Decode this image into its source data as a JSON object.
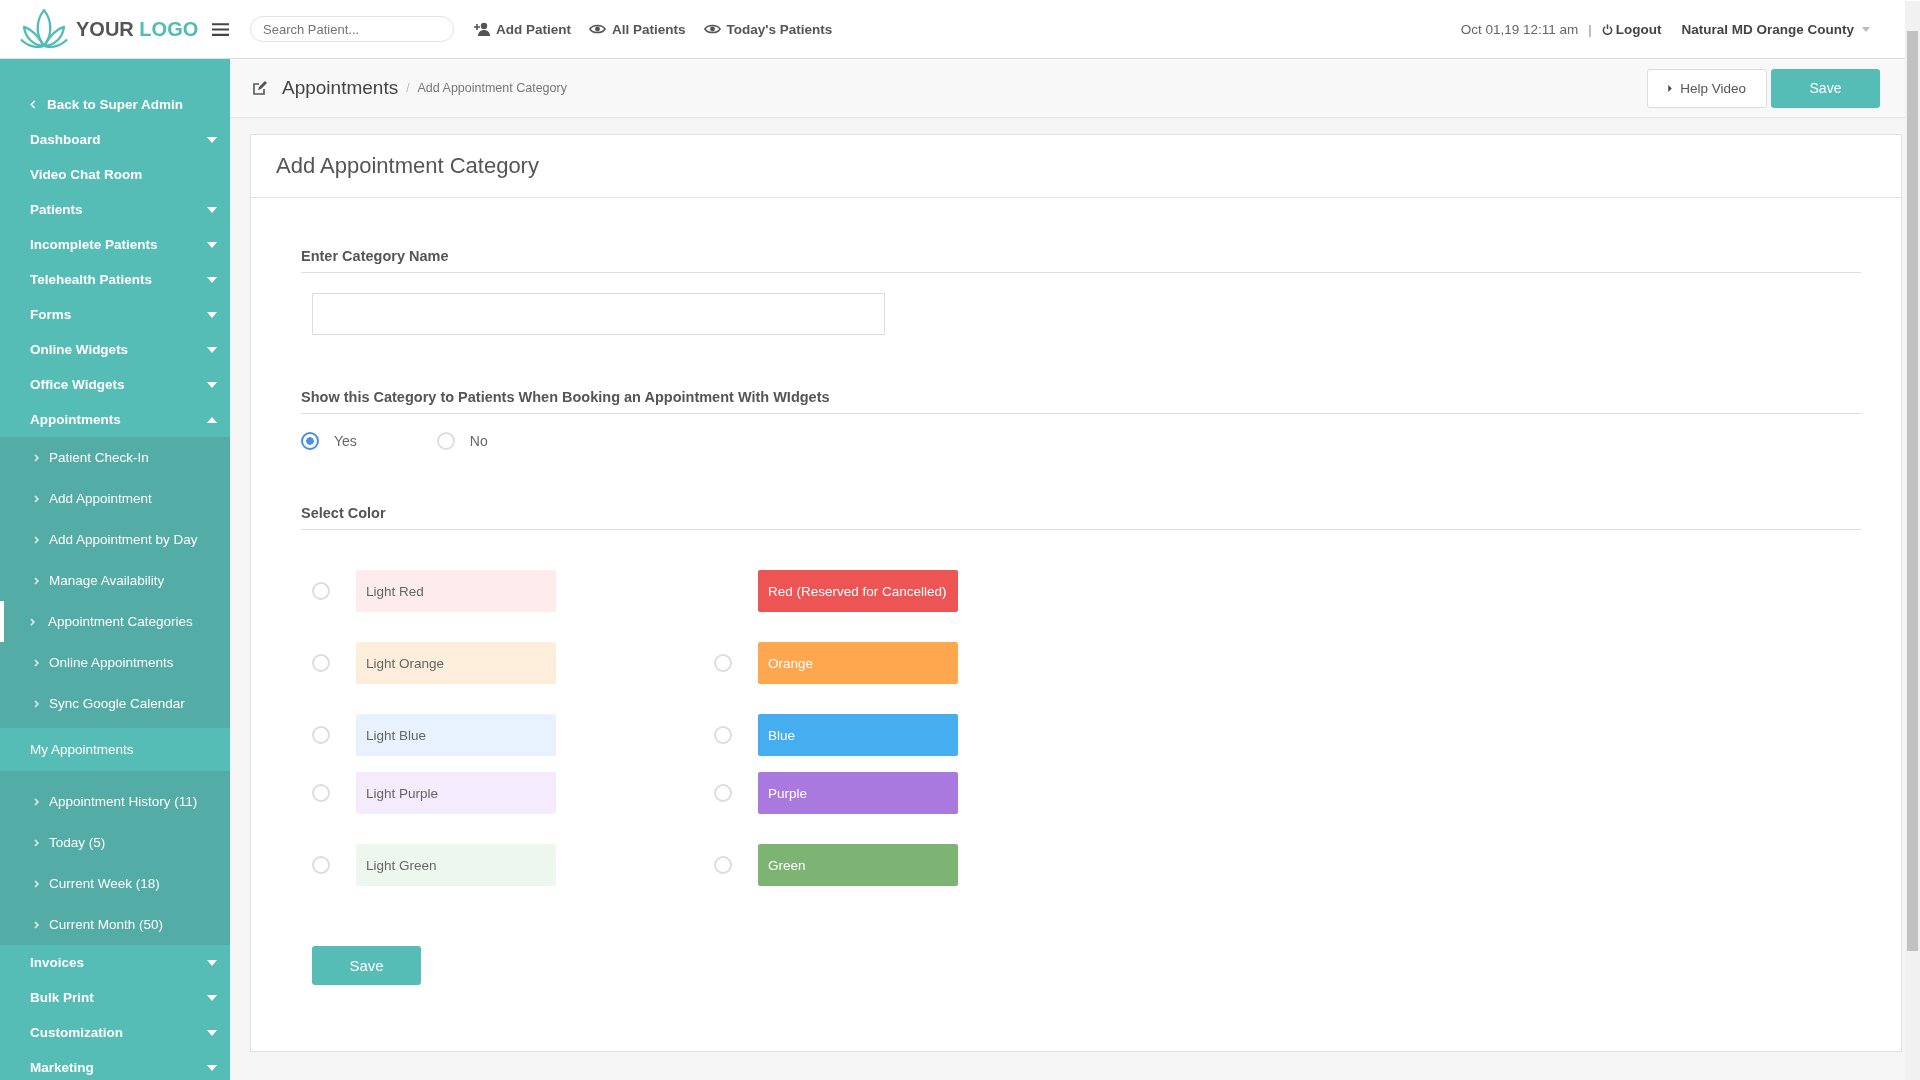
{
  "topbar": {
    "logo": {
      "first": "YOUR",
      "second": "LOGO"
    },
    "search": {
      "placeholder": "Search Patient..."
    },
    "links": [
      {
        "label": "Add Patient",
        "kind": "add-user"
      },
      {
        "label": "All Patients",
        "kind": "eye"
      },
      {
        "label": "Today's Patients",
        "kind": "eye"
      }
    ],
    "datetime": "Oct 01,19 12:11 am",
    "separator": "|",
    "logout": "Logout",
    "account": "Natural MD Orange County"
  },
  "sidebar": {
    "items": [
      {
        "label": "Back to Super Admin",
        "kind": "back"
      },
      {
        "label": "Dashboard",
        "kind": "menu",
        "expanded": false
      },
      {
        "label": "Video Chat Room",
        "kind": "link"
      },
      {
        "label": "Patients",
        "kind": "menu",
        "expanded": false
      },
      {
        "label": "Incomplete Patients",
        "kind": "menu",
        "expanded": false
      },
      {
        "label": "Telehealth Patients",
        "kind": "menu",
        "expanded": false
      },
      {
        "label": "Forms",
        "kind": "menu",
        "expanded": false
      },
      {
        "label": "Online Widgets",
        "kind": "menu",
        "expanded": false
      },
      {
        "label": "Office Widgets",
        "kind": "menu",
        "expanded": false
      },
      {
        "label": "Appointments",
        "kind": "menu",
        "expanded": true,
        "children": [
          {
            "label": "Patient Check-In",
            "kind": "sub",
            "selected": false
          },
          {
            "label": "Add Appointment",
            "kind": "sub",
            "selected": false
          },
          {
            "label": "Add Appointment by Day",
            "kind": "sub",
            "selected": false
          },
          {
            "label": "Manage Availability",
            "kind": "sub",
            "selected": false
          },
          {
            "label": "Appointment Categories",
            "kind": "sub",
            "selected": true
          },
          {
            "label": "Online Appointments",
            "kind": "sub",
            "selected": false
          },
          {
            "label": "Sync Google Calendar",
            "kind": "sub",
            "selected": false
          },
          {
            "label": "My Appointments",
            "kind": "heading"
          },
          {
            "label": "Appointment History (11)",
            "kind": "sub",
            "selected": false
          },
          {
            "label": "Today (5)",
            "kind": "sub",
            "selected": false
          },
          {
            "label": "Current Week (18)",
            "kind": "sub",
            "selected": false
          },
          {
            "label": "Current Month (50)",
            "kind": "sub",
            "selected": false
          }
        ]
      },
      {
        "label": "Invoices",
        "kind": "menu",
        "expanded": false
      },
      {
        "label": "Bulk Print",
        "kind": "menu",
        "expanded": false
      },
      {
        "label": "Customization",
        "kind": "menu",
        "expanded": false
      },
      {
        "label": "Marketing",
        "kind": "menu",
        "expanded": false
      }
    ]
  },
  "page_header": {
    "title": "Appointments",
    "separator": "/",
    "breadcrumb": "Add Appointment Category",
    "help_button": "Help Video",
    "save_button": "Save"
  },
  "form": {
    "title": "Add Appointment Category",
    "name_section": {
      "label": "Enter Category Name"
    },
    "show_section": {
      "label": "Show this Category to Patients When Booking an Appointment With WIdgets",
      "options": [
        {
          "label": "Yes",
          "selected": true
        },
        {
          "label": "No",
          "selected": false
        }
      ]
    },
    "color_section": {
      "label": "Select Color",
      "rows": [
        [
          {
            "label": "Light Red",
            "color": "#fdeceb",
            "kind": "option",
            "selected": false
          },
          {
            "label": "Red (Reserved for Cancelled)",
            "color": "#ed5554",
            "kind": "reserved"
          }
        ],
        [
          {
            "label": "Light Orange",
            "color": "#fdeedb",
            "kind": "option",
            "selected": false
          },
          {
            "label": "Orange",
            "color": "#fea74f",
            "kind": "option",
            "selected": false
          }
        ],
        [
          {
            "label": "Light Blue",
            "color": "#e7f2fe",
            "kind": "option",
            "selected": false
          },
          {
            "label": "Blue",
            "color": "#45aef1",
            "kind": "option",
            "selected": false
          }
        ],
        [
          {
            "label": "Light Purple",
            "color": "#f4ebfc",
            "kind": "option",
            "selected": false
          },
          {
            "label": "Purple",
            "color": "#aa79df",
            "kind": "option",
            "selected": false
          }
        ],
        [
          {
            "label": "Light Green",
            "color": "#eef7ee",
            "kind": "option",
            "selected": false
          },
          {
            "label": "Green",
            "color": "#7db474",
            "kind": "option",
            "selected": false
          }
        ]
      ]
    },
    "save_button": "Save"
  }
}
